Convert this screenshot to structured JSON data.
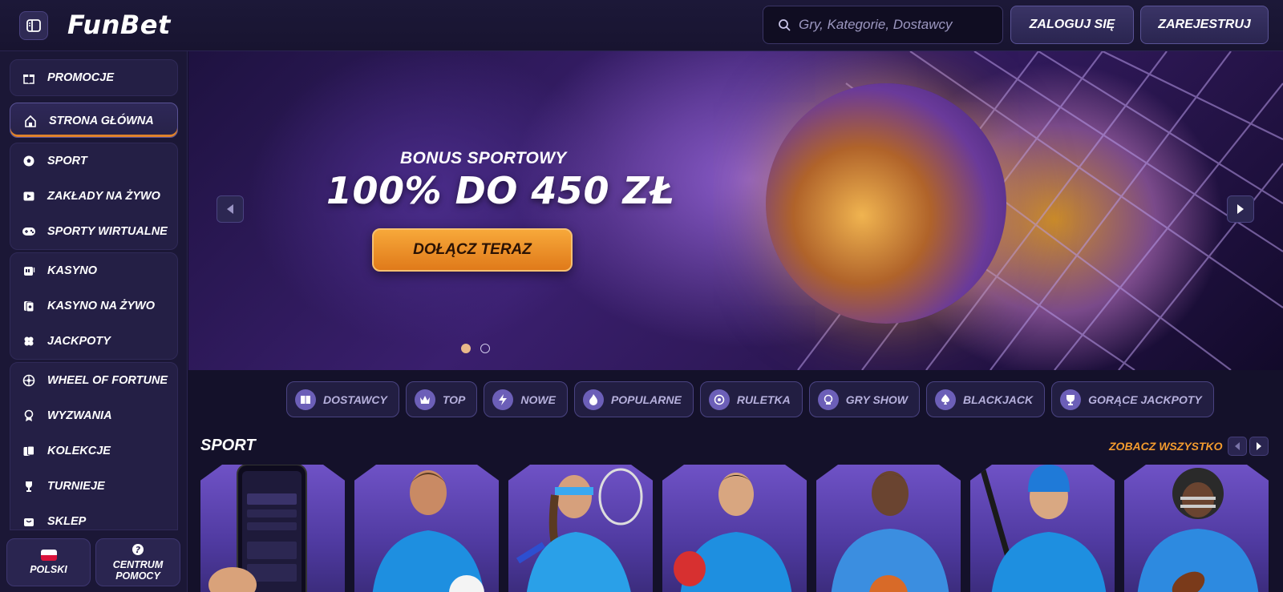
{
  "header": {
    "logo": "FunBet",
    "search_placeholder": "Gry, Kategorie, Dostawcy",
    "login_label": "ZALOGUJ SIĘ",
    "register_label": "ZAREJESTRUJ"
  },
  "sidebar": {
    "promotions": "PROMOCJE",
    "home": "STRONA GŁÓWNA",
    "sport_group": [
      "SPORT",
      "ZAKŁADY NA ŻYWO",
      "SPORTY WIRTUALNE"
    ],
    "casino_group": [
      "KASYNO",
      "KASYNO NA ŻYWO",
      "JACKPOTY"
    ],
    "extra_group": [
      "WHEEL OF FORTUNE",
      "WYZWANIA",
      "KOLEKCJE",
      "TURNIEJE",
      "SKLEP"
    ],
    "language": "POLSKI",
    "help_line1": "CENTRUM",
    "help_line2": "POMOCY"
  },
  "hero": {
    "subtitle": "BONUS SPORTOWY",
    "title": "100% DO 450 ZŁ",
    "cta": "DOŁĄCZ TERAZ"
  },
  "categories": [
    "DOSTAWCY",
    "TOP",
    "NOWE",
    "POPULARNE",
    "RULETKA",
    "GRY SHOW",
    "BLACKJACK",
    "GORĄCE JACKPOTY"
  ],
  "sport": {
    "title": "SPORT",
    "see_all": "ZOBACZ WSZYSTKO"
  },
  "colors": {
    "accent_orange": "#f39b2e",
    "bg": "#14112a",
    "purple": "#6c5fb8"
  }
}
